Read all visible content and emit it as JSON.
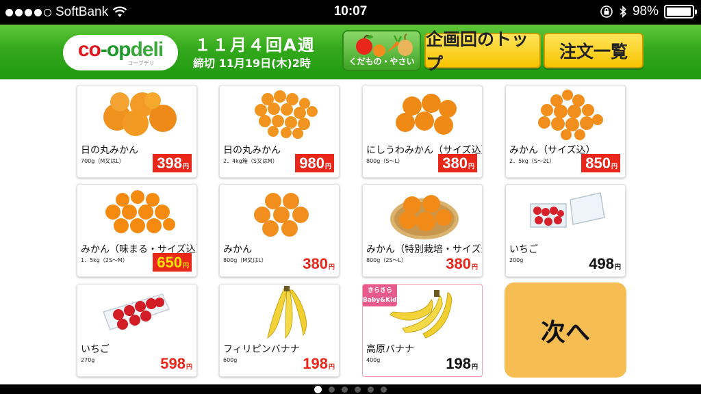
{
  "status_bar": {
    "carrier": "SoftBank",
    "time": "10:07",
    "battery": "98%",
    "battery_level": 0.98,
    "signal_bars": 4,
    "signal_bars_max": 5
  },
  "header": {
    "logo_text": "co-opdeli",
    "logo_subtext": "コープデリ",
    "week_title": "１１月４回A週",
    "deadline": "締切 11月19日(木)2時",
    "category_button": "くだもの・やさい",
    "top_button": "企画回のトップ",
    "order_list_button": "注文一覧"
  },
  "products": [
    {
      "name": "日の丸みかん",
      "amount": "700g（M又はL）",
      "price": "398",
      "yen": "円",
      "style": "red"
    },
    {
      "name": "日の丸みかん",
      "amount": "2．4kg箱（S又はM）",
      "price": "980",
      "yen": "円",
      "style": "red"
    },
    {
      "name": "にしうわみかん（サイズ込）",
      "amount": "800g（S〜L）",
      "price": "380",
      "yen": "円",
      "style": "red"
    },
    {
      "name": "みかん（サイズ込）",
      "amount": "2．5kg（S〜2L）",
      "price": "850",
      "yen": "円",
      "style": "red"
    },
    {
      "name": "みかん（味まる・サイズ込）",
      "amount": "1．5kg（2S〜M）",
      "price": "650",
      "yen": "円",
      "style": "ylw"
    },
    {
      "name": "みかん",
      "amount": "800g（M又はL）",
      "price": "380",
      "yen": "円",
      "style": "redtxt"
    },
    {
      "name": "みかん（特別栽培・サイズ込）",
      "amount": "800g（2S〜L）",
      "price": "380",
      "yen": "円",
      "style": "redtxt"
    },
    {
      "name": "いちご",
      "amount": "200g",
      "price": "498",
      "yen": "円",
      "style": "blk"
    },
    {
      "name": "いちご",
      "amount": "270g",
      "price": "598",
      "yen": "円",
      "style": "redtxt"
    },
    {
      "name": "フィリピンバナナ",
      "amount": "600g",
      "price": "198",
      "yen": "円",
      "style": "redtxt"
    },
    {
      "name": "高原バナナ",
      "amount": "400g",
      "price": "198",
      "yen": "円",
      "style": "blk",
      "badge": "きらきら Baby&Kids"
    }
  ],
  "next_button": "次へ",
  "pager": {
    "pages": 6,
    "current": 1
  },
  "colors": {
    "header_green": "#33a81c",
    "button_yellow": "#f7c400",
    "price_red": "#e8261a",
    "next_orange": "#f6bd52"
  }
}
